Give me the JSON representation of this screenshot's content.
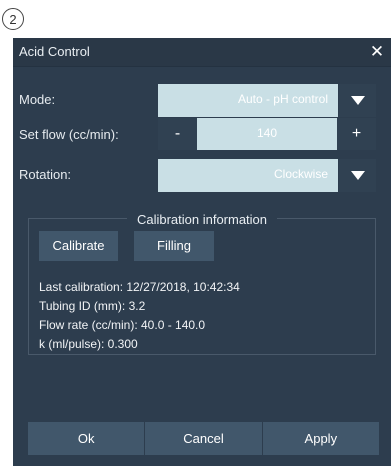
{
  "step_number": "2",
  "dialog": {
    "title": "Acid Control",
    "close_glyph": "✕"
  },
  "form": {
    "mode": {
      "label": "Mode:",
      "value": "Auto - pH control"
    },
    "set_flow": {
      "label": "Set flow (cc/min):",
      "value": "140",
      "minus": "-",
      "plus": "+"
    },
    "rotation": {
      "label": "Rotation:",
      "value": "Clockwise"
    }
  },
  "calibration": {
    "title": "Calibration information",
    "calibrate_label": "Calibrate",
    "filling_label": "Filling",
    "lines": [
      "Last calibration: 12/27/2018, 10:42:34",
      "Tubing ID (mm): 3.2",
      "Flow rate (cc/min): 40.0 - 140.0",
      "k (ml/pulse): 0.300"
    ]
  },
  "footer": {
    "ok": "Ok",
    "cancel": "Cancel",
    "apply": "Apply"
  },
  "colors": {
    "dialog_bg": "#2d3d4e",
    "field_bg": "#c9dfe5",
    "button_bg": "#41576b"
  },
  "icons": {
    "close": "close-icon",
    "dropdown": "chevron-down-icon"
  }
}
